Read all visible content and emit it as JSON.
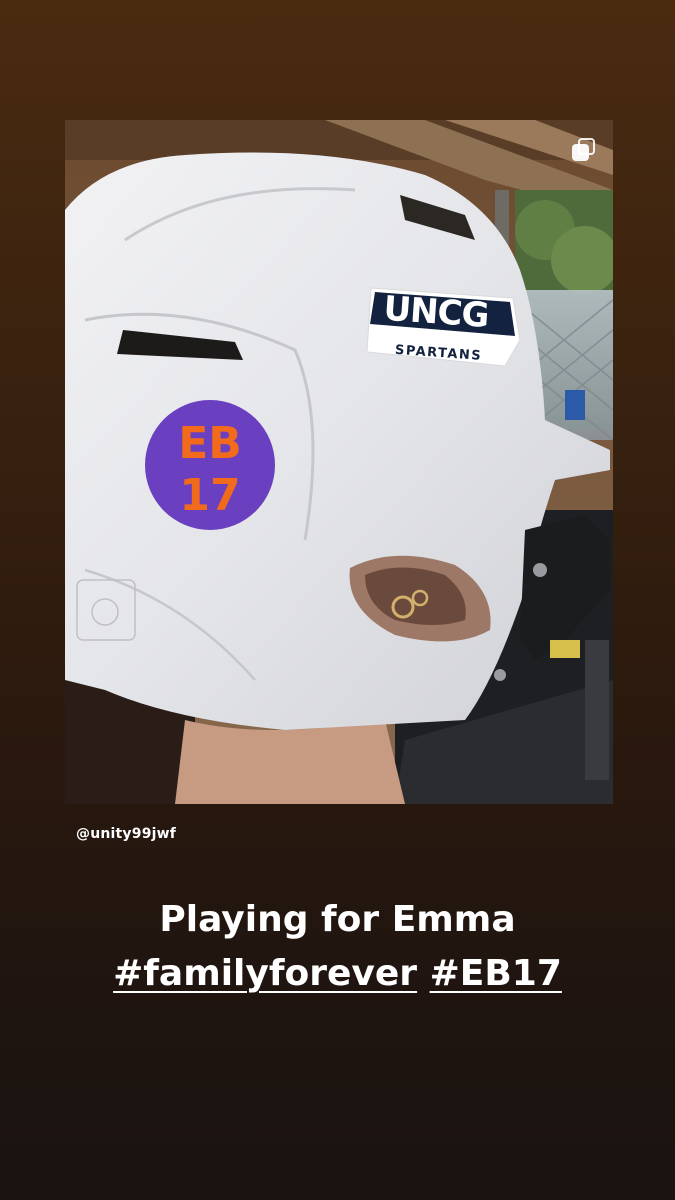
{
  "story": {
    "credit_username": "@unity99jwf",
    "caption_line1": "Playing for Emma",
    "hashtags": [
      "#familyforever",
      "#EB17"
    ],
    "multi_photo_icon": "carousel-stack-icon"
  },
  "photo": {
    "description_subject": "white batting helmet",
    "logo_wordmark": "UNCG",
    "logo_subtitle": "SPARTANS",
    "sticker_line1": "EB",
    "sticker_line2": "17",
    "sticker_colors": {
      "circle": "#6a3fc0",
      "text": "#f26a1b"
    },
    "logo_colors": {
      "navy": "#13233f",
      "gold": "#c9a64b"
    }
  },
  "colors": {
    "background_top": "#4a2b10",
    "background_bottom": "#1a1311",
    "text": "#ffffff"
  }
}
